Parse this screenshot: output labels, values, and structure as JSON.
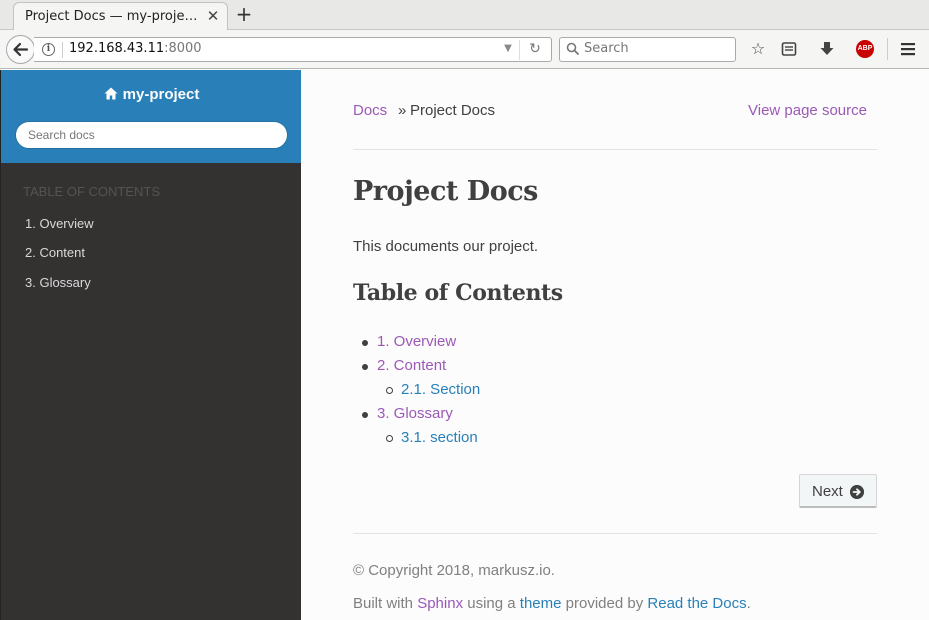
{
  "browser": {
    "tab_title": "Project Docs — my-proje…",
    "url_host": "192.168.43.11",
    "url_port": ":8000",
    "search_placeholder": "Search"
  },
  "sidebar": {
    "project": "my-project",
    "search_placeholder": "Search docs",
    "caption": "TABLE OF CONTENTS",
    "items": [
      {
        "label": "1. Overview"
      },
      {
        "label": "2. Content"
      },
      {
        "label": "3. Glossary"
      }
    ]
  },
  "breadcrumb": {
    "root": "Docs",
    "separator": "»",
    "current": "Project Docs",
    "view_source": "View page source"
  },
  "main": {
    "title": "Project Docs",
    "intro": "This documents our project.",
    "toc_heading": "Table of Contents",
    "toc": [
      {
        "label": "1. Overview",
        "level": 1
      },
      {
        "label": "2. Content",
        "level": 1
      },
      {
        "label": "2.1. Section",
        "level": 2
      },
      {
        "label": "3. Glossary",
        "level": 1
      },
      {
        "label": "3.1. section",
        "level": 2
      }
    ],
    "next_label": "Next"
  },
  "footer": {
    "copyright": "© Copyright 2018, markusz.io.",
    "built_prefix": "Built with ",
    "sphinx": "Sphinx",
    "using": " using a ",
    "theme": "theme",
    "provided": " provided by ",
    "rtd": "Read the Docs",
    "period": "."
  },
  "colors": {
    "sidebar_head": "#2980b9",
    "sidebar_bg": "#343131",
    "visited_link": "#9b59b6",
    "link": "#2980b9"
  }
}
